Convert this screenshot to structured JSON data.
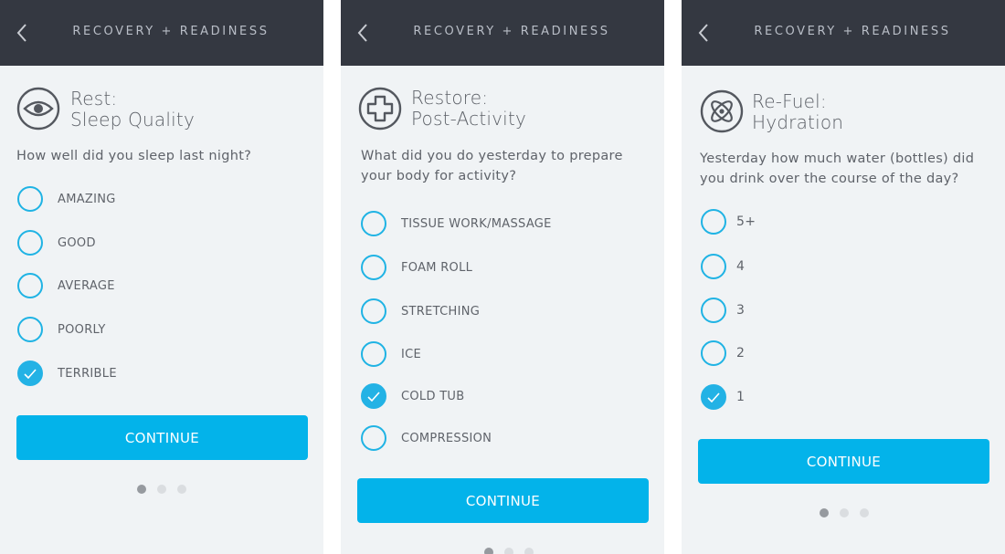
{
  "screens": [
    {
      "header_title": "RECOVERY + READINESS",
      "category_icon": "eye-icon",
      "category_line1": "Rest:",
      "category_line2": "Sleep Quality",
      "question_line1": "How well did you sleep last night?",
      "options": [
        {
          "label": "AMAZING",
          "checked": false
        },
        {
          "label": "GOOD",
          "checked": false
        },
        {
          "label": "AVERAGE",
          "checked": false
        },
        {
          "label": "POORLY",
          "checked": false
        },
        {
          "label": "TERRIBLE",
          "checked": true
        }
      ],
      "continue_label": "CONTINUE",
      "page_indicator": {
        "total": 3,
        "active": 1
      }
    },
    {
      "header_title": "RECOVERY + READINESS",
      "category_icon": "medical-cross-icon",
      "category_line1": "Restore:",
      "category_line2": "Post-Activity",
      "question_line1": "What did you do yesterday to prepare",
      "question_line2": "your body for activity?",
      "options": [
        {
          "label": "TISSUE WORK/MASSAGE",
          "checked": false
        },
        {
          "label": "FOAM ROLL",
          "checked": false
        },
        {
          "label": "STRETCHING",
          "checked": false
        },
        {
          "label": "ICE",
          "checked": false
        },
        {
          "label": "COLD TUB",
          "checked": true
        },
        {
          "label": "COMPRESSION",
          "checked": false
        }
      ],
      "continue_label": "CONTINUE",
      "page_indicator": {
        "total": 3,
        "active": 1
      }
    },
    {
      "header_title": "RECOVERY + READINESS",
      "category_icon": "atom-icon",
      "category_line1": "Re-Fuel:",
      "category_line2": "Hydration",
      "question_line1": "Yesterday how much water (bottles) did",
      "question_line2": "you drink over the course of the day?",
      "options": [
        {
          "label": "5+",
          "checked": false
        },
        {
          "label": "4",
          "checked": false
        },
        {
          "label": "3",
          "checked": false
        },
        {
          "label": "2",
          "checked": false
        },
        {
          "label": "1",
          "checked": true
        }
      ],
      "continue_label": "CONTINUE",
      "page_indicator": {
        "total": 3,
        "active": 1
      }
    }
  ],
  "colors": {
    "header_bg": "#343841",
    "screen_bg": "#f0f3f5",
    "accent": "#03b3ea",
    "radio_ring": "#1fb3e4",
    "text": "#5f636a"
  }
}
